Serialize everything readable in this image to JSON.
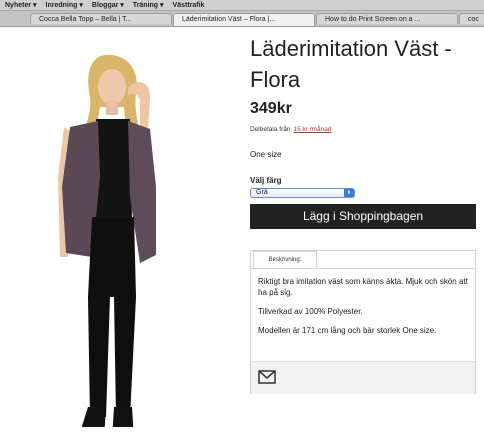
{
  "bookmarks": [
    "Nyheter ▾",
    "Inredning ▾",
    "Bloggar ▾",
    "Träning ▾",
    "Västtrafik"
  ],
  "tabs": [
    {
      "label": "Cocca Bella Topp – Bella | T..."
    },
    {
      "label": "Läderimitation Väst – Flora |..."
    },
    {
      "label": "How to do Print Screen on a ..."
    },
    {
      "label": "coc"
    }
  ],
  "product": {
    "title": "Läderimitation Väst - Flora",
    "price": "349kr",
    "installment_prefix": "Delbetala från",
    "installment_link": "15 kr /månad",
    "size": "One size",
    "color_label": "Välj färg",
    "color_selected": "Grå",
    "add_to_cart": "Lägg i Shoppingbagen"
  },
  "description": {
    "tab_label": "Beskrivning:",
    "paragraphs": [
      "Riktigt bra imitation väst som känns äkta. Mjuk och skön att ha på sig.",
      "Tillverkad av 100% Polyester.",
      "Modellen är 171 cm lång och bär storlek One size."
    ]
  },
  "icons": {
    "share": "mail-icon",
    "select_arrow": "chevron-up-down-icon"
  }
}
